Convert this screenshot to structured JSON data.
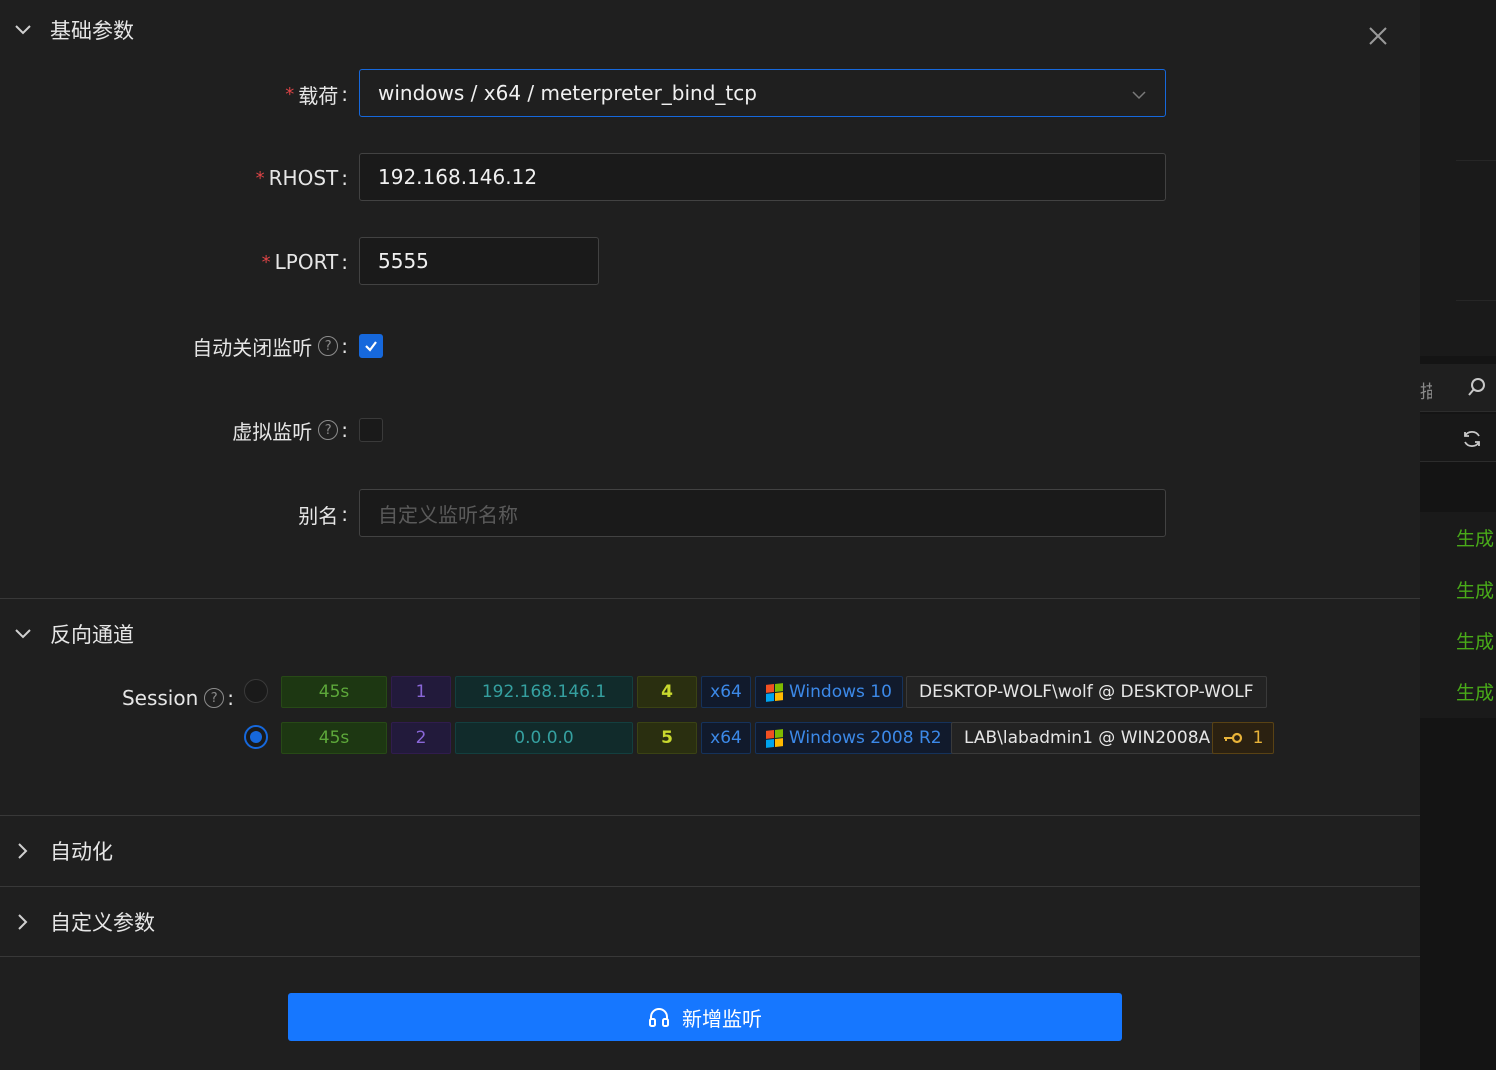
{
  "sections": {
    "basic": {
      "title": "基础参数",
      "expanded": true
    },
    "reverse": {
      "title": "反向通道",
      "expanded": true
    },
    "automation": {
      "title": "自动化",
      "expanded": false
    },
    "custom": {
      "title": "自定义参数",
      "expanded": false
    }
  },
  "form": {
    "payload": {
      "label": "载荷",
      "value": "windows / x64 / meterpreter_bind_tcp",
      "required": true
    },
    "rhost": {
      "label": "RHOST",
      "value": "192.168.146.12",
      "required": true
    },
    "lport": {
      "label": "LPORT",
      "value": "5555",
      "required": true
    },
    "auto_close": {
      "label": "自动关闭监听",
      "checked": true
    },
    "virtual": {
      "label": "虚拟监听",
      "checked": false
    },
    "alias": {
      "label": "别名",
      "value": "",
      "placeholder": "自定义监听名称"
    },
    "colon": ":",
    "help_glyph": "?"
  },
  "session": {
    "label": "Session",
    "rows": [
      {
        "selected": false,
        "time": "45s",
        "id": "1",
        "ip": "192.168.146.1",
        "num": "4",
        "arch": "x64",
        "os": "Windows 10",
        "user": "DESKTOP-WOLF\\wolf @ DESKTOP-WOLF"
      },
      {
        "selected": true,
        "time": "45s",
        "id": "2",
        "ip": "0.0.0.0",
        "num": "5",
        "arch": "x64",
        "os": "Windows 2008 R2",
        "user": "LAB\\labadmin1 @ WIN2008A",
        "key_count": "1"
      }
    ]
  },
  "submit_label": "新增监听",
  "background": {
    "tab_fragment": "描",
    "row_action": "生成"
  },
  "colors": {
    "primary": "#1677ff",
    "panel": "#1f1f1f",
    "required": "#dc4446"
  }
}
